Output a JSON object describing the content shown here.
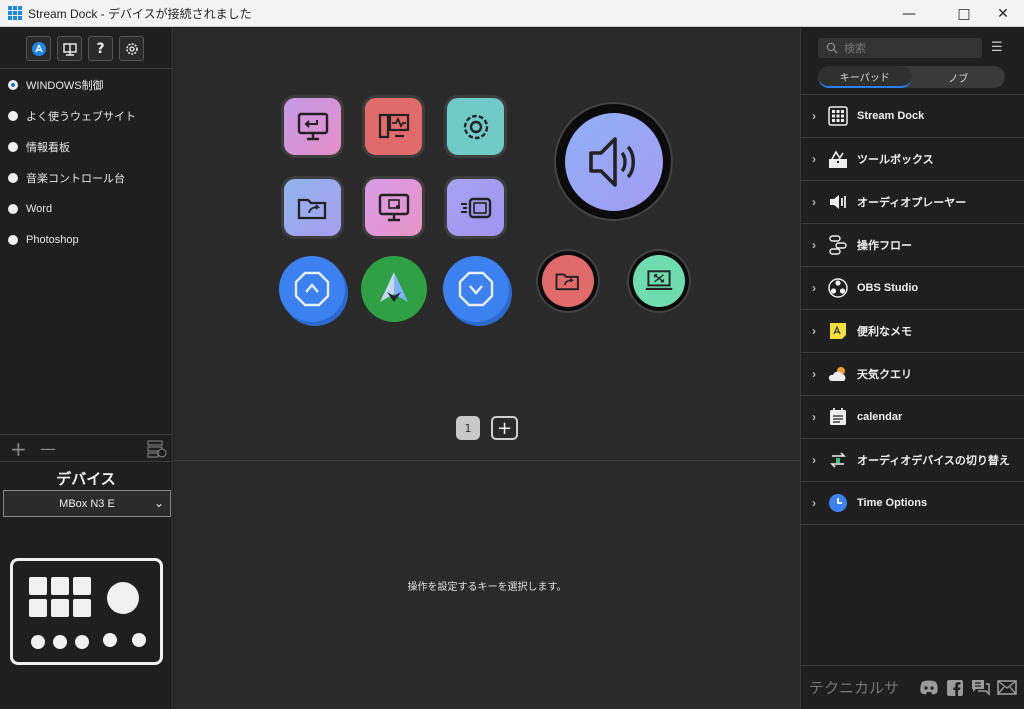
{
  "window": {
    "title": "Stream Dock - デバイスが接続されました",
    "controls": [
      "—",
      "□",
      "✕"
    ]
  },
  "toolbar": {
    "store_icon": "app-store-icon",
    "tray_icon": "tray-icon",
    "help_label": "?",
    "settings_icon": "gear-icon"
  },
  "profiles": {
    "items": [
      {
        "label": "WINDOWS制御",
        "selected": true
      },
      {
        "label": "よく使うウェブサイト",
        "selected": false
      },
      {
        "label": "情報看板",
        "selected": false
      },
      {
        "label": "音楽コントロール台",
        "selected": false
      },
      {
        "label": "Word",
        "selected": false
      },
      {
        "label": "Photoshop",
        "selected": false
      }
    ],
    "add_label": "+",
    "remove_label": "—"
  },
  "device": {
    "title": "デバイス",
    "selected": "MBox N3 E"
  },
  "pager": {
    "current": "1",
    "add_label": "+"
  },
  "center": {
    "hint": "操作を設定するキーを選択します。"
  },
  "search": {
    "placeholder": "検索"
  },
  "tabs": [
    {
      "label": "キーパッド",
      "active": true
    },
    {
      "label": "ノブ",
      "active": false
    }
  ],
  "categories": [
    {
      "label": "Stream Dock",
      "icon": "grid-icon"
    },
    {
      "label": "ツールボックス",
      "icon": "toolbox-icon"
    },
    {
      "label": "オーディオプレーヤー",
      "icon": "audio-player-icon"
    },
    {
      "label": "操作フロー",
      "icon": "flow-icon"
    },
    {
      "label": "OBS Studio",
      "icon": "obs-icon"
    },
    {
      "label": "便利なメモ",
      "icon": "memo-icon"
    },
    {
      "label": "天気クエリ",
      "icon": "weather-icon"
    },
    {
      "label": "calendar",
      "icon": "calendar-icon"
    },
    {
      "label": "オーディオデバイスの切り替え",
      "icon": "audio-switch-icon"
    },
    {
      "label": "Time Options",
      "icon": "clock-icon"
    }
  ],
  "footer": {
    "brand": "テクニカルサ"
  },
  "colors": {
    "accent": "#2a7df4",
    "panel": "#1f1f1f",
    "canvas": "#2a2a2a"
  }
}
